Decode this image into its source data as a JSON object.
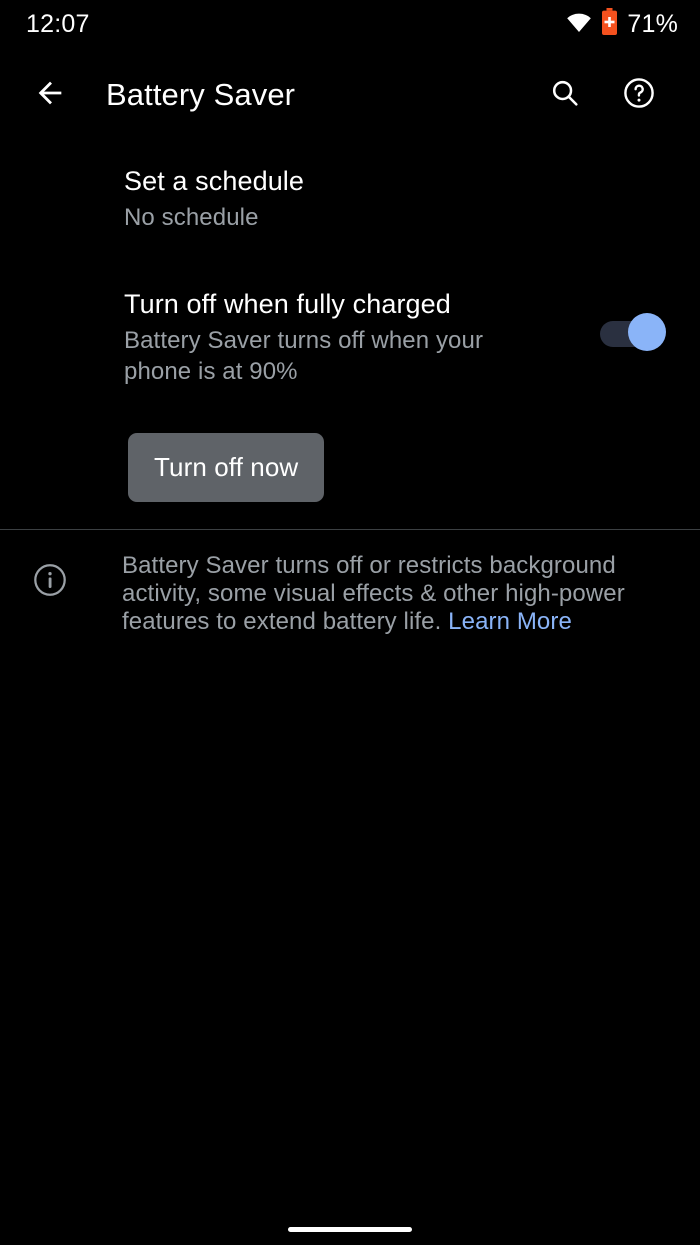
{
  "status_bar": {
    "time": "12:07",
    "battery_percent": "71%",
    "wifi_icon": "wifi-icon",
    "battery_icon": "battery-saver-icon",
    "battery_icon_color": "#f4511e"
  },
  "app_bar": {
    "back_icon": "back-arrow-icon",
    "title": "Battery Saver",
    "search_icon": "search-icon",
    "help_icon": "help-icon"
  },
  "preferences": [
    {
      "title": "Set a schedule",
      "summary": "No schedule"
    },
    {
      "title": "Turn off when fully charged",
      "summary": "Battery Saver turns off when your phone is at 90%",
      "switch_state": "on"
    }
  ],
  "action_button": {
    "label": "Turn off now"
  },
  "footer": {
    "info_icon": "info-icon",
    "text": "Battery Saver turns off or restricts background activity, some visual effects & other high-power features to extend battery life.",
    "link_label": "Learn More"
  },
  "navigation": {
    "home_indicator": "home-indicator"
  },
  "colors": {
    "background": "#000000",
    "primary_text": "#ffffff",
    "secondary_text": "#9aa0a6",
    "accent": "#8ab4f8",
    "button_bg": "#5f6368",
    "switch_track": "#2a3040",
    "divider": "#3c4043"
  }
}
